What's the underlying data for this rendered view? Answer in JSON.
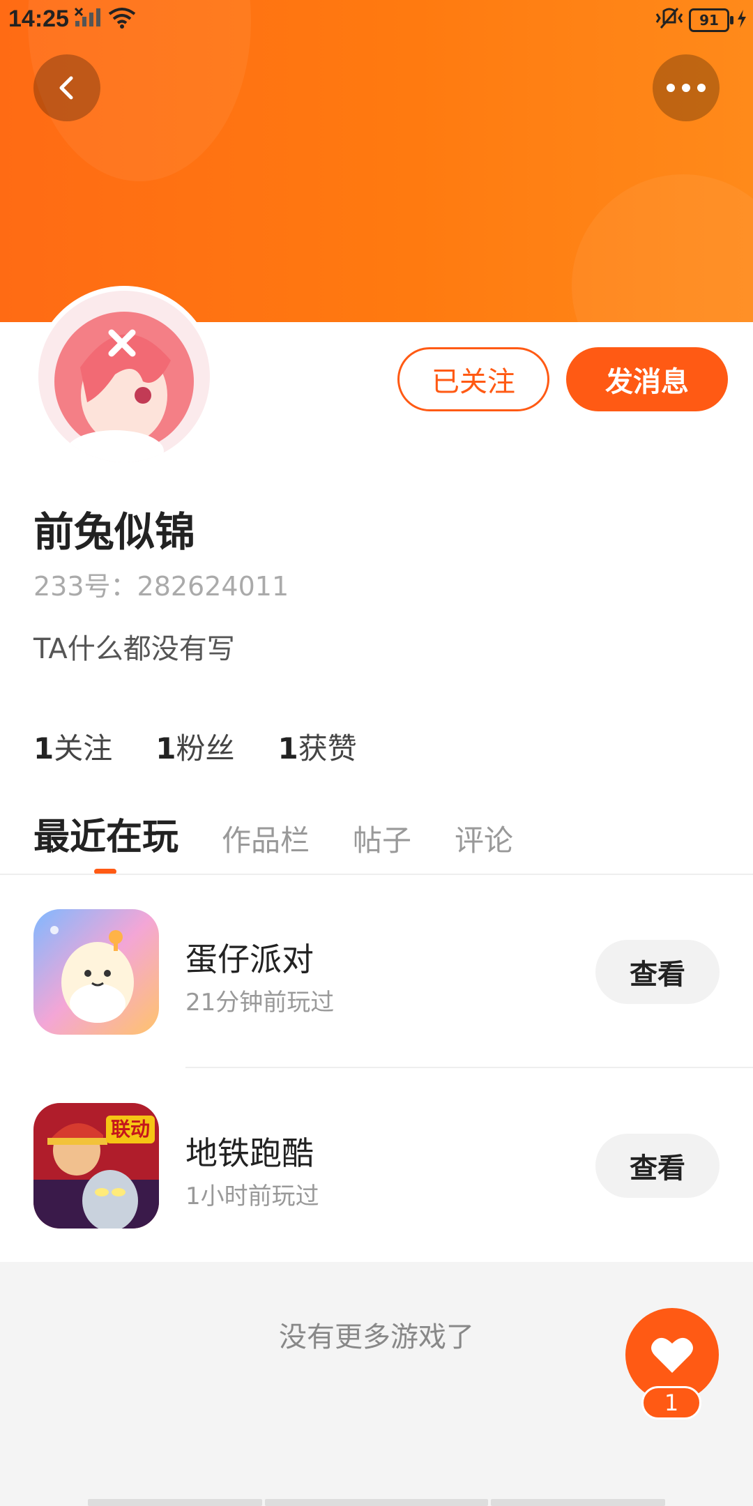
{
  "status_bar": {
    "time": "14:25",
    "battery": "91"
  },
  "colors": {
    "accent": "#ff5a14",
    "banner": "#ff7a10"
  },
  "header": {
    "back_icon": "chevron-left-icon",
    "more_icon": "more-dots-icon"
  },
  "profile": {
    "name": "前兔似锦",
    "id_text": "233号：282624011",
    "bio": "TA什么都没有写",
    "follow_button": "已关注",
    "message_button": "发消息",
    "stats": [
      {
        "count": "1",
        "label": "关注"
      },
      {
        "count": "1",
        "label": "粉丝"
      },
      {
        "count": "1",
        "label": "获赞"
      }
    ]
  },
  "tabs": [
    {
      "label": "最近在玩",
      "active": true
    },
    {
      "label": "作品栏",
      "active": false
    },
    {
      "label": "帖子",
      "active": false
    },
    {
      "label": "评论",
      "active": false
    }
  ],
  "games": [
    {
      "name": "蛋仔派对",
      "last_played": "21分钟前玩过",
      "action": "查看"
    },
    {
      "name": "地铁跑酷",
      "last_played": "1小时前玩过",
      "action": "查看",
      "icon_badge": "联动"
    }
  ],
  "footer": {
    "no_more_text": "没有更多游戏了"
  },
  "like_button": {
    "count": "1",
    "icon": "heart-icon"
  }
}
